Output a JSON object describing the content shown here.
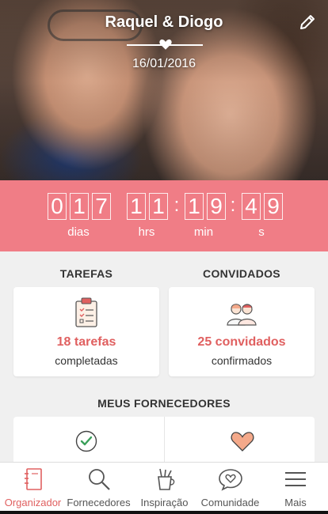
{
  "header": {
    "couple_names": "Raquel & Diogo",
    "wedding_date": "16/01/2016"
  },
  "countdown": {
    "days_digits": [
      "0",
      "1",
      "7"
    ],
    "hours_digits": [
      "1",
      "1"
    ],
    "minutes_digits": [
      "1",
      "9"
    ],
    "seconds_digits": [
      "4",
      "9"
    ],
    "days_label": "dias",
    "hours_label": "hrs",
    "minutes_label": "min",
    "seconds_label": "s"
  },
  "tasks": {
    "title": "TAREFAS",
    "count_text": "18 tarefas",
    "sub_text": "completadas",
    "icon": "clipboard-checklist-icon"
  },
  "guests": {
    "title": "CONVIDADOS",
    "count_text": "25 convidados",
    "sub_text": "confirmados",
    "icon": "couple-icon"
  },
  "vendors": {
    "title": "MEUS FORNECEDORES"
  },
  "nav": {
    "items": [
      {
        "label": "Organizador",
        "icon": "notebook-icon",
        "active": true
      },
      {
        "label": "Fornecedores",
        "icon": "search-icon",
        "active": false
      },
      {
        "label": "Inspiração",
        "icon": "brush-cup-icon",
        "active": false
      },
      {
        "label": "Comunidade",
        "icon": "chat-heart-icon",
        "active": false
      },
      {
        "label": "Mais",
        "icon": "menu-icon",
        "active": false
      }
    ]
  },
  "colors": {
    "accent": "#f07d86",
    "accent_text": "#e06060",
    "green_check": "#3aa05a",
    "heart_fill": "#f4a98a"
  }
}
